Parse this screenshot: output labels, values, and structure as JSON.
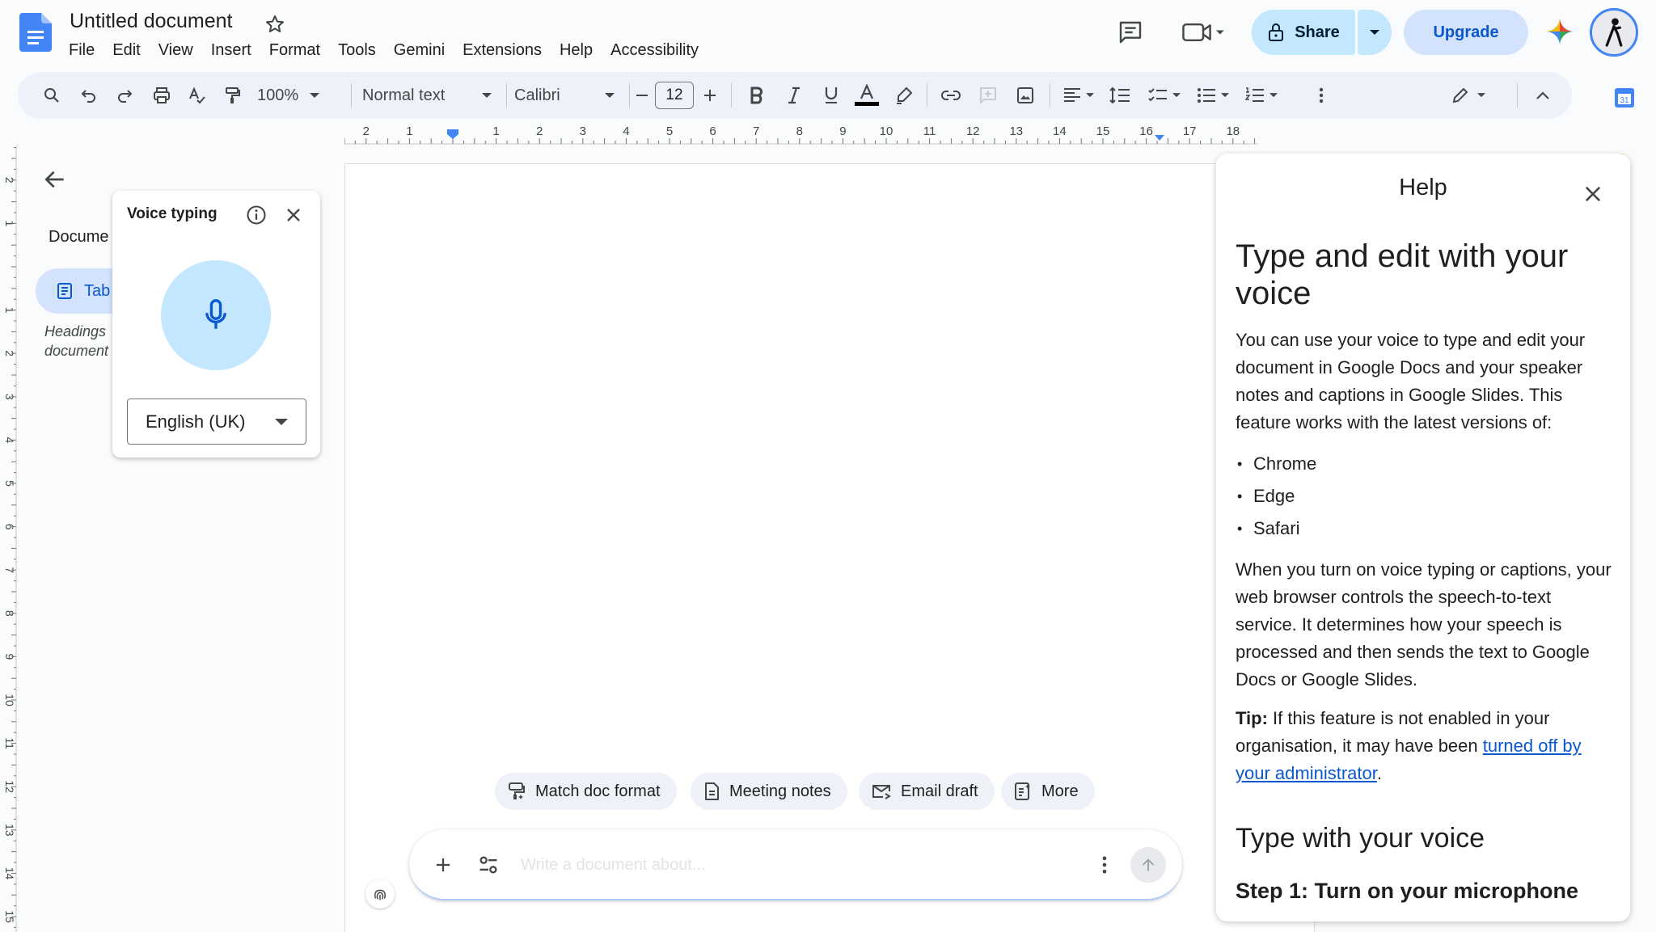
{
  "header": {
    "title": "Untitled document",
    "menus": [
      "File",
      "Edit",
      "View",
      "Insert",
      "Format",
      "Tools",
      "Gemini",
      "Extensions",
      "Help",
      "Accessibility"
    ],
    "share_label": "Share",
    "upgrade_label": "Upgrade"
  },
  "toolbar": {
    "zoom": "100%",
    "style": "Normal text",
    "font": "Calibri",
    "font_size": "12"
  },
  "ruler": {
    "horizontal_ticks": [
      "2",
      "1",
      "1",
      "2",
      "3",
      "4",
      "5",
      "6",
      "7",
      "8",
      "9",
      "10",
      "11",
      "12",
      "13",
      "14",
      "15",
      "16",
      "17",
      "18"
    ],
    "vertical_ticks": [
      "2",
      "1",
      "1",
      "2",
      "3",
      "4",
      "5",
      "6",
      "7",
      "8",
      "9",
      "10",
      "11",
      "12",
      "13",
      "14",
      "15"
    ]
  },
  "outline": {
    "title": "Docume",
    "tab_label": "Tab",
    "hint": "Headings document"
  },
  "voice_typing": {
    "title": "Voice typing",
    "language": "English (UK)"
  },
  "gemini": {
    "chips": [
      "Match doc format",
      "Meeting notes",
      "Email draft",
      "More"
    ],
    "placeholder": "Write a document about..."
  },
  "help": {
    "header": "Help",
    "heading": "Type and edit with your voice",
    "intro": "You can use your voice to type and edit your document in Google Docs and your speaker notes and captions in Google Slides. This feature works with the latest versions of:",
    "browsers": [
      "Chrome",
      "Edge",
      "Safari"
    ],
    "para2": "When you turn on voice typing or captions, your web browser controls the speech-to-text service. It determines how your speech is processed and then sends the text to Google Docs or Google Slides.",
    "tip_label": "Tip:",
    "tip_text": " If this feature is not enabled in your organisation, it may have been ",
    "tip_link": "turned off by your administrator",
    "tip_end": ".",
    "section2": "Type with your voice",
    "step1": "Step 1: Turn on your microphone"
  },
  "colors": {
    "accent": "#0b57d0",
    "share_bg": "#c2e7ff",
    "upgrade_bg": "#d3e3fd",
    "toolbar_bg": "#edf2fa",
    "mic_bg": "#c2e7ff"
  },
  "icons": [
    "docs-logo-icon",
    "star-icon",
    "comments-icon",
    "video-call-icon",
    "lock-icon",
    "gemini-icon",
    "search-icon",
    "undo-icon",
    "redo-icon",
    "print-icon",
    "spellcheck-icon",
    "paint-format-icon",
    "microphone-icon",
    "info-icon",
    "close-icon",
    "back-arrow-icon"
  ]
}
